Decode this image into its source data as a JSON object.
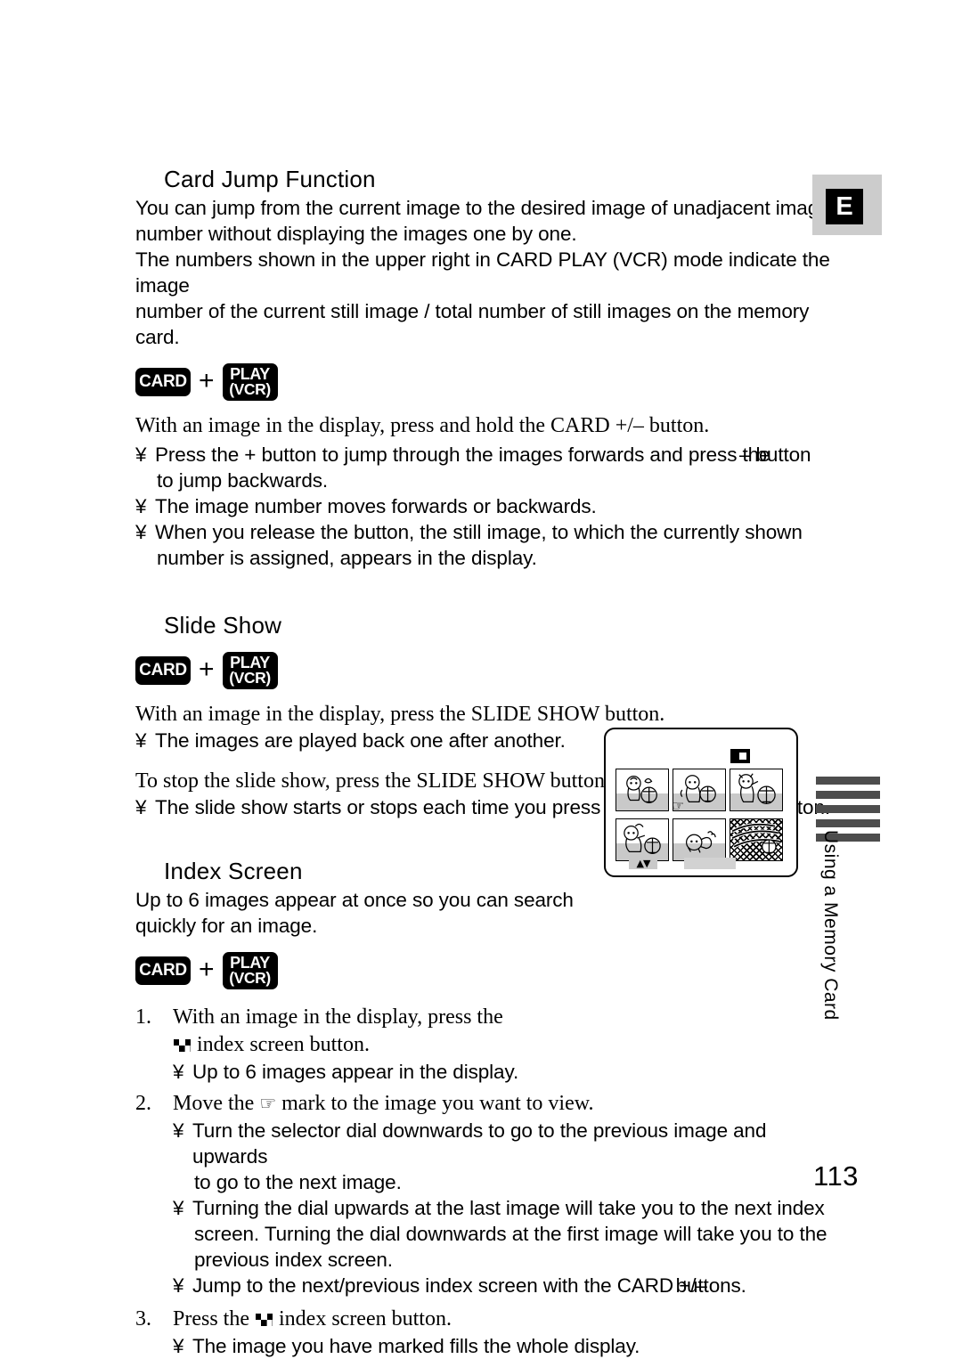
{
  "page": {
    "number": "113",
    "language_marker": "E",
    "side_tab_label": "Using a Memory Card"
  },
  "sections": [
    {
      "id": "card-jump",
      "heading": "Card Jump Function",
      "intro": [
        "You can jump from the current image to the desired image of unadjacent image",
        "number without displaying the images one by one.",
        "The numbers shown in the upper right in CARD PLAY (VCR) mode indicate the image",
        "number of the current still image / total number of still images on the memory card."
      ],
      "buttons": {
        "card": "CARD",
        "plus": "+",
        "play_line1": "PLAY",
        "play_line2": "(VCR)"
      },
      "instruction": "With an image in the display, press and hold the CARD +/– button.",
      "bullets": [
        {
          "mark": "¥",
          "overlap": true,
          "text_a": "Press the + button to jump through the images forwards and press the",
          "text_b": "– button",
          "continuation": "to jump backwards."
        },
        {
          "mark": "¥",
          "text": "The image number moves forwards or backwards."
        },
        {
          "mark": "¥",
          "text": "When you release the button, the still image, to which the currently shown",
          "continuation": "number is assigned, appears in the display."
        }
      ]
    },
    {
      "id": "slide-show",
      "heading": "Slide Show",
      "buttons": {
        "card": "CARD",
        "plus": "+",
        "play_line1": "PLAY",
        "play_line2": "(VCR)"
      },
      "instruction_start": "With an image in the display, press the SLIDE SHOW button.",
      "bullet_start": {
        "mark": "¥",
        "text": "The images are played back one after another."
      },
      "instruction_stop": "To stop the slide show, press the SLIDE SHOW button.",
      "bullet_stop": {
        "mark": "¥",
        "text": "The slide show starts or stops each time you press the SLIDE SHOW button."
      }
    },
    {
      "id": "index-screen",
      "heading": "Index Screen",
      "intro": [
        "Up to 6 images appear at once so you can search",
        "quickly for an image."
      ],
      "buttons": {
        "card": "CARD",
        "plus": "+",
        "play_line1": "PLAY",
        "play_line2": "(VCR)"
      },
      "steps": [
        {
          "num": "1.",
          "text_before_icon": "With an image in the display, press the",
          "icon": "index-screen-icon",
          "text_after_icon": "index screen button.",
          "bullets": [
            {
              "mark": "¥",
              "text": "Up to 6 images appear in the display."
            }
          ]
        },
        {
          "num": "2.",
          "text_before_icon": "Move the",
          "icon": "pointing-hand-icon",
          "icon_glyph": "☞",
          "text_after_icon": "mark to the image you want to view.",
          "bullets": [
            {
              "mark": "¥",
              "text": "Turn the selector dial downwards to go to the previous image and upwards",
              "continuation": "to go to the next image."
            },
            {
              "mark": "¥",
              "text": "Turning the dial upwards at the last image will take you to the next index",
              "continuation": "screen. Turning the dial downwards at the first image will take you to the",
              "continuation2": "previous index screen."
            },
            {
              "mark": "¥",
              "overlap": true,
              "text_a": "Jump to the next/previous index screen with the CARD +/–",
              "text_b": "buttons."
            }
          ]
        },
        {
          "num": "3.",
          "text_before_icon": "Press the",
          "icon": "index-screen-icon",
          "text_after_icon": "index screen button.",
          "bullets": [
            {
              "mark": "¥",
              "text": "The image you have marked fills the whole display."
            }
          ]
        }
      ]
    }
  ],
  "illustration": {
    "name": "index-screen-illustration",
    "card_icon": "memory-card-icon",
    "hand_marker": "☞",
    "updown_marker": "▲▼",
    "thumbnails": [
      {
        "id": 1,
        "content": "baby-with-soccer-ball"
      },
      {
        "id": 2,
        "content": "baby-holding-soccer-ball"
      },
      {
        "id": 3,
        "content": "baby-reaching-for-ball"
      },
      {
        "id": 4,
        "content": "baby-lying-with-ball"
      },
      {
        "id": 5,
        "content": "baby-crawling"
      },
      {
        "id": 6,
        "content": "soccer-goal-net"
      }
    ]
  },
  "colors": {
    "badge_bg": "#000000",
    "badge_text": "#ffffff",
    "marker_gray": "#cccccc",
    "side_bar": "#4d4d4d",
    "thumb_ground": "#c9c9c9"
  }
}
